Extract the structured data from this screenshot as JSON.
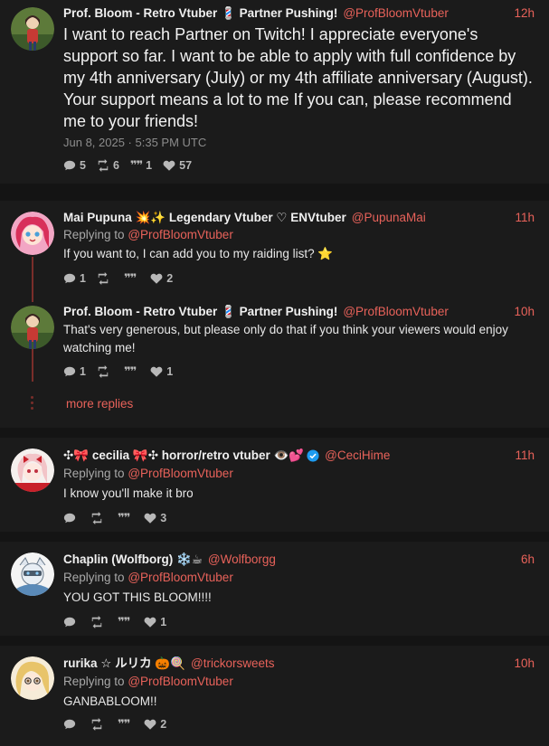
{
  "main_post": {
    "author": "Prof. Bloom - Retro Vtuber 💈 Partner Pushing!",
    "handle": "@ProfBloomVtuber",
    "time": "12h",
    "text": "I want to reach Partner on Twitch!  I appreciate everyone's support so far.  I want to be able to apply with full confidence by my 4th anniversary (July) or my 4th affiliate anniversary (August). Your support means a lot to me  If you can, please recommend me to your friends!",
    "date": "Jun 8, 2025 · 5:35 PM UTC",
    "replies": "5",
    "reposts": "6",
    "quotes": "1",
    "likes": "57"
  },
  "replies": [
    {
      "author": "Mai Pupuna 💥✨ Legendary Vtuber ♡ ENVtuber",
      "handle": "@PupunaMai",
      "time": "11h",
      "replying_label": "Replying to",
      "replying_handle": "@ProfBloomVtuber",
      "text": "If you want to, I can add you to my raiding list? ⭐",
      "replies": "1",
      "reposts": "",
      "quotes": "",
      "likes": "2"
    },
    {
      "author": "Prof. Bloom - Retro Vtuber 💈 Partner Pushing!",
      "handle": "@ProfBloomVtuber",
      "time": "10h",
      "text": "That's very generous, but please only do that if you think your viewers would enjoy watching me!",
      "replies": "1",
      "reposts": "",
      "quotes": "",
      "likes": "1"
    },
    {
      "author": "✣🎀 cecilia 🎀✣  horror/retro vtuber 👁️💕",
      "handle": "@CeciHime",
      "time": "11h",
      "replying_label": "Replying to",
      "replying_handle": "@ProfBloomVtuber",
      "text": "I know you'll make it bro",
      "replies": "",
      "reposts": "",
      "quotes": "",
      "likes": "3"
    },
    {
      "author": "Chaplin (Wolfborg) ❄️☕",
      "handle": "@Wolfborgg",
      "time": "6h",
      "replying_label": "Replying to",
      "replying_handle": "@ProfBloomVtuber",
      "text": "YOU GOT THIS BLOOM!!!!",
      "replies": "",
      "reposts": "",
      "quotes": "",
      "likes": "1"
    },
    {
      "author": "rurika ☆ ルリカ 🎃🍭",
      "handle": "@trickorsweets",
      "time": "10h",
      "replying_label": "Replying to",
      "replying_handle": "@ProfBloomVtuber",
      "text": "GANBABLOOM!!",
      "replies": "",
      "reposts": "",
      "quotes": "",
      "likes": "2"
    }
  ],
  "more_replies_label": "more replies",
  "icons": {
    "reply": "comment-icon",
    "repost": "retweet-icon",
    "quote": "quote-icon",
    "like": "heart-icon",
    "verified": "verified-badge-icon"
  },
  "colors": {
    "background": "#141414",
    "card": "#1b1b1b",
    "accent": "#e8625a",
    "thread_line": "#7a2e2a",
    "verified": "#1d9bf0"
  }
}
